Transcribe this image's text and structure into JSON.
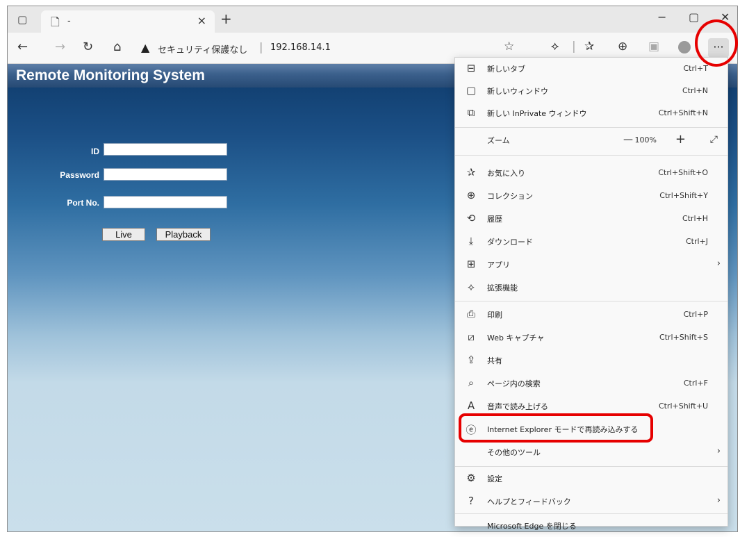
{
  "tab": {
    "title": "-"
  },
  "window_controls": {
    "minimize": "−",
    "maximize": "▢",
    "close": "✕"
  },
  "address": {
    "security_label": "セキュリティ保護なし",
    "separator": "|",
    "url": "192.168.14.1"
  },
  "page": {
    "title": "Remote Monitoring System",
    "id_label": "ID",
    "password_label": "Password",
    "port_label": "Port No.",
    "live_button": "Live",
    "playback_button": "Playback"
  },
  "menu": {
    "items": [
      {
        "label": "新しいタブ",
        "shortcut": "Ctrl+T"
      },
      {
        "label": "新しいウィンドウ",
        "shortcut": "Ctrl+N"
      },
      {
        "label": "新しい InPrivate ウィンドウ",
        "shortcut": "Ctrl+Shift+N"
      },
      {
        "label": "ズーム",
        "zoom_value": "100%"
      },
      {
        "label": "お気に入り",
        "shortcut": "Ctrl+Shift+O"
      },
      {
        "label": "コレクション",
        "shortcut": "Ctrl+Shift+Y"
      },
      {
        "label": "履歴",
        "shortcut": "Ctrl+H"
      },
      {
        "label": "ダウンロード",
        "shortcut": "Ctrl+J"
      },
      {
        "label": "アプリ"
      },
      {
        "label": "拡張機能"
      },
      {
        "label": "印刷",
        "shortcut": "Ctrl+P"
      },
      {
        "label": "Web キャプチャ",
        "shortcut": "Ctrl+Shift+S"
      },
      {
        "label": "共有"
      },
      {
        "label": "ページ内の検索",
        "shortcut": "Ctrl+F"
      },
      {
        "label": "音声で読み上げる",
        "shortcut": "Ctrl+Shift+U"
      },
      {
        "label": "Internet Explorer モードで再読み込みする"
      },
      {
        "label": "その他のツール"
      },
      {
        "label": "設定"
      },
      {
        "label": "ヘルプとフィードバック"
      },
      {
        "label": "Microsoft Edge を閉じる"
      }
    ]
  },
  "colors": {
    "highlight": "#e60000",
    "page_header": "#274a74"
  }
}
